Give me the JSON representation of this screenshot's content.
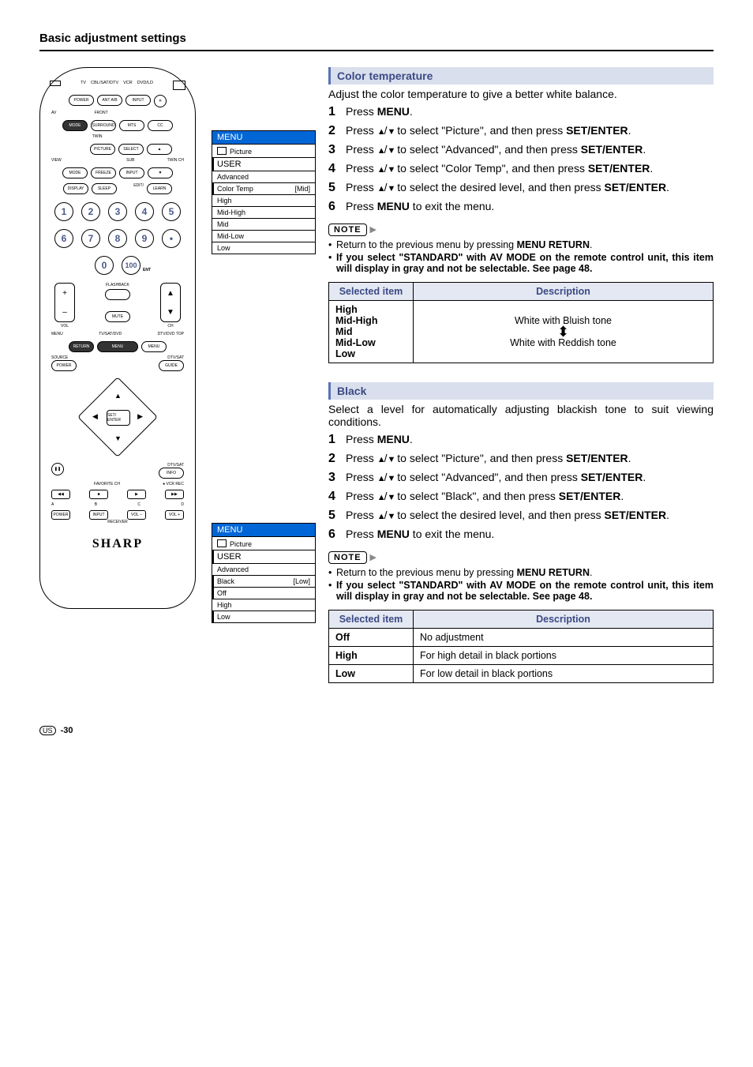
{
  "page_title": "Basic adjustment settings",
  "footer": {
    "region": "US",
    "page": "-30"
  },
  "remote": {
    "top_labels": [
      "TV",
      "CBL/SAT/DTV",
      "VCR",
      "DVD/LD"
    ],
    "row1": [
      "POWER",
      "ANT A/B",
      "INPUT",
      "✳"
    ],
    "row2_labels_top": [
      "AV",
      "FRONT",
      "",
      ""
    ],
    "row2": [
      "MODE",
      "SURROUND",
      "MTS",
      "CC"
    ],
    "row3_labels_top": [
      "",
      "TWIN",
      "",
      ""
    ],
    "row3": [
      "PICTURE",
      "SELECT",
      "▲"
    ],
    "row4_labels_top": [
      "VIEW",
      "",
      "SUB",
      "TWIN CH"
    ],
    "row4": [
      "MODE",
      "FREEZE",
      "INPUT",
      "▼"
    ],
    "row5": [
      "DISPLAY",
      "SLEEP",
      "EDIT/",
      "LEARN"
    ],
    "numbers": [
      "1",
      "2",
      "3",
      "4",
      "5",
      "6",
      "7",
      "8",
      "9",
      "•",
      "0",
      "100"
    ],
    "ent": "ENT",
    "vol": "VOL",
    "ch": "CH",
    "mute": "MUTE",
    "flashback": "FLASHBACK",
    "menu_row": [
      "MENU",
      "TV/SAT/DVD",
      "DTV/DVD TOP"
    ],
    "menu_btns": [
      "RETURN",
      "MENU",
      "MENU"
    ],
    "source_row": [
      "SOURCE",
      "",
      "DTV/SAT"
    ],
    "power_guide": [
      "POWER",
      "",
      "GUIDE"
    ],
    "set_enter": "SET/\nENTER",
    "info": "INFO",
    "dtvsat": "DTV/SAT",
    "fav": "FAVORITE CH",
    "vcr": "VCR REC",
    "transport": [
      "◀◀",
      "■",
      "▶",
      "▶▶"
    ],
    "abcd": [
      "A",
      "B",
      "C",
      "D"
    ],
    "receiver_row": [
      "POWER",
      "INPUT",
      "VOL –",
      "VOL +"
    ],
    "receiver": "RECEIVER",
    "brand": "SHARP"
  },
  "osd1": {
    "title": "MENU",
    "picture": "Picture",
    "user": "USER",
    "advanced": "Advanced",
    "item": "Color Temp",
    "value": "[Mid]",
    "options": [
      "High",
      "Mid-High",
      "Mid",
      "Mid-Low",
      "Low"
    ]
  },
  "osd2": {
    "title": "MENU",
    "picture": "Picture",
    "user": "USER",
    "advanced": "Advanced",
    "item": "Black",
    "value": "[Low]",
    "options": [
      "Off",
      "High",
      "Low"
    ]
  },
  "section1": {
    "heading": "Color temperature",
    "intro": "Adjust the color temperature to give a better white balance.",
    "steps": [
      {
        "pre": "Press ",
        "bold": "MENU",
        "post": "."
      },
      {
        "pre": "Press ",
        "arrows": true,
        "mid": " to select \"Picture\", and then press ",
        "bold": "SET/ENTER",
        "post": "."
      },
      {
        "pre": "Press ",
        "arrows": true,
        "mid": " to select \"Advanced\", and then press ",
        "bold": "SET/ENTER",
        "post": "."
      },
      {
        "pre": "Press ",
        "arrows": true,
        "mid": " to select \"Color Temp\", and then press ",
        "bold": "SET/ENTER",
        "post": "."
      },
      {
        "pre": "Press ",
        "arrows": true,
        "mid": " to select the desired level, and then press ",
        "bold": "SET/ENTER",
        "post": "."
      },
      {
        "pre": "Press ",
        "bold": "MENU",
        "post": " to exit the menu."
      }
    ],
    "note_label": "NOTE",
    "notes": [
      {
        "text": "Return to the previous menu by pressing ",
        "bold": "MENU RETURN",
        "post": "."
      },
      {
        "bold_full": "If you select \"STANDARD\" with AV MODE on the remote control unit, this item will display in gray and not be selectable. See page 48."
      }
    ],
    "table": {
      "h1": "Selected item",
      "h2": "Description",
      "items": [
        "High",
        "Mid-High",
        "Mid",
        "Mid-Low",
        "Low"
      ],
      "desc_top": "White with Bluish tone",
      "desc_bottom": "White with Reddish tone"
    }
  },
  "section2": {
    "heading": "Black",
    "intro": "Select a level for automatically adjusting blackish tone to suit viewing conditions.",
    "steps": [
      {
        "pre": "Press ",
        "bold": "MENU",
        "post": "."
      },
      {
        "pre": "Press ",
        "arrows": true,
        "mid": " to select \"Picture\", and then press ",
        "bold": "SET/ENTER",
        "post": "."
      },
      {
        "pre": "Press ",
        "arrows": true,
        "mid": " to select \"Advanced\", and then press ",
        "bold": "SET/ENTER",
        "post": "."
      },
      {
        "pre": "Press ",
        "arrows": true,
        "mid": " to select \"Black\", and then press ",
        "bold": "SET/ENTER",
        "post": "."
      },
      {
        "pre": "Press ",
        "arrows": true,
        "mid": " to select the desired level, and then press ",
        "bold": "SET/ENTER",
        "post": "."
      },
      {
        "pre": "Press ",
        "bold": "MENU",
        "post": " to exit the menu."
      }
    ],
    "note_label": "NOTE",
    "notes": [
      {
        "text": "Return to the previous menu by pressing ",
        "bold": "MENU RETURN",
        "post": "."
      },
      {
        "bold_full": "If you select \"STANDARD\" with AV MODE on the remote control unit, this item will display in gray and not be selectable. See page 48."
      }
    ],
    "table": {
      "h1": "Selected item",
      "h2": "Description",
      "rows": [
        {
          "item": "Off",
          "desc": "No adjustment"
        },
        {
          "item": "High",
          "desc": "For high detail in black portions"
        },
        {
          "item": "Low",
          "desc": "For low detail in black portions"
        }
      ]
    }
  }
}
